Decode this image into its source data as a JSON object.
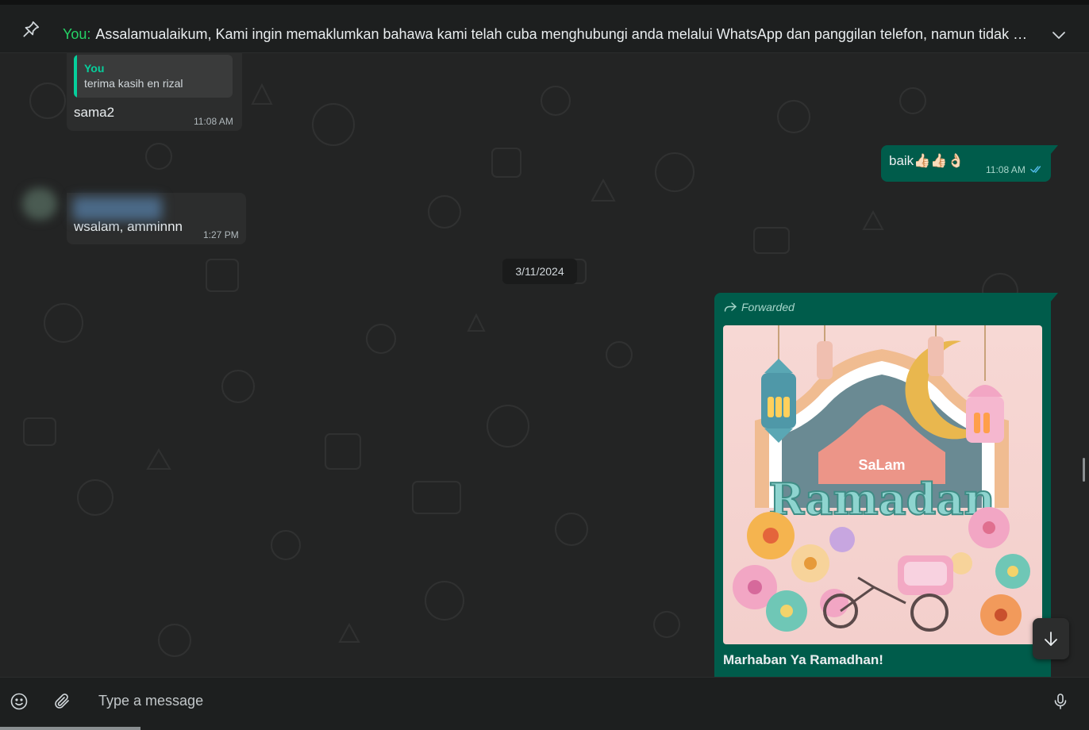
{
  "pinned": {
    "sender": "You:",
    "text": "Assalamualaikum,  Kami ingin memaklumkan bahawa kami telah cuba menghubungi anda melalui WhatsApp dan panggilan telefon, namun tidak menerima sebarang maklum balas."
  },
  "messages": [
    {
      "direction": "in",
      "quote_name": "You",
      "quote_text": "terima kasih en rizal",
      "text": "sama2",
      "time": "11:08 AM"
    },
    {
      "direction": "out",
      "text": "baik👍🏻👍🏻👌🏻",
      "time": "11:08 AM",
      "status": "read"
    },
    {
      "direction": "in",
      "text": "wsalam, amminnn",
      "time": "1:27 PM"
    }
  ],
  "date_divider": "3/11/2024",
  "forwarded_message": {
    "forwarded_label": "Forwarded",
    "image_lettering": [
      "SaLam",
      "Ramadan"
    ],
    "caption": "Marhaban Ya Ramadhan!"
  },
  "composer": {
    "placeholder": "Type a message"
  },
  "colors": {
    "accent": "#25d366",
    "outgoing_bubble": "#005c4b",
    "incoming_bubble": "#2c2d2d",
    "read_ticks": "#53bdeb"
  }
}
